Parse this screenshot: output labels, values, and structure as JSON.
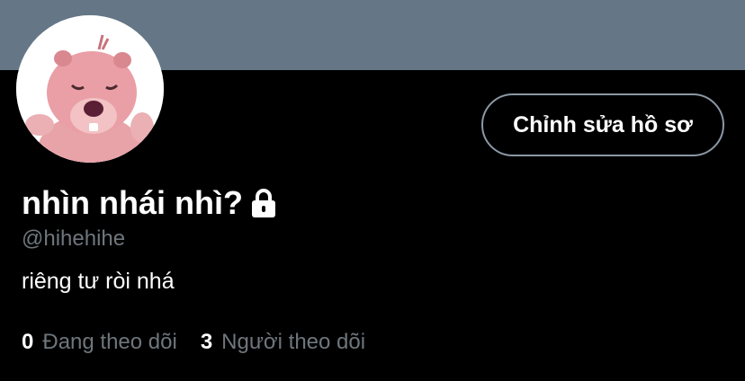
{
  "theme": {
    "banner_color": "#657786",
    "background": "#000000",
    "button_border": "#8b98a5",
    "muted_text": "#6e767d"
  },
  "profile": {
    "display_name": "nhìn nhái nhì?",
    "handle": "@hihehihe",
    "bio": "riêng tư ròi nhá",
    "protected_icon": "lock-icon",
    "avatar": "pink-beaver-cartoon"
  },
  "actions": {
    "edit_profile_label": "Chỉnh sửa hồ sơ"
  },
  "stats": {
    "following_count": "0",
    "following_label": "Đang theo dõi",
    "followers_count": "3",
    "followers_label": "Người theo dõi"
  }
}
